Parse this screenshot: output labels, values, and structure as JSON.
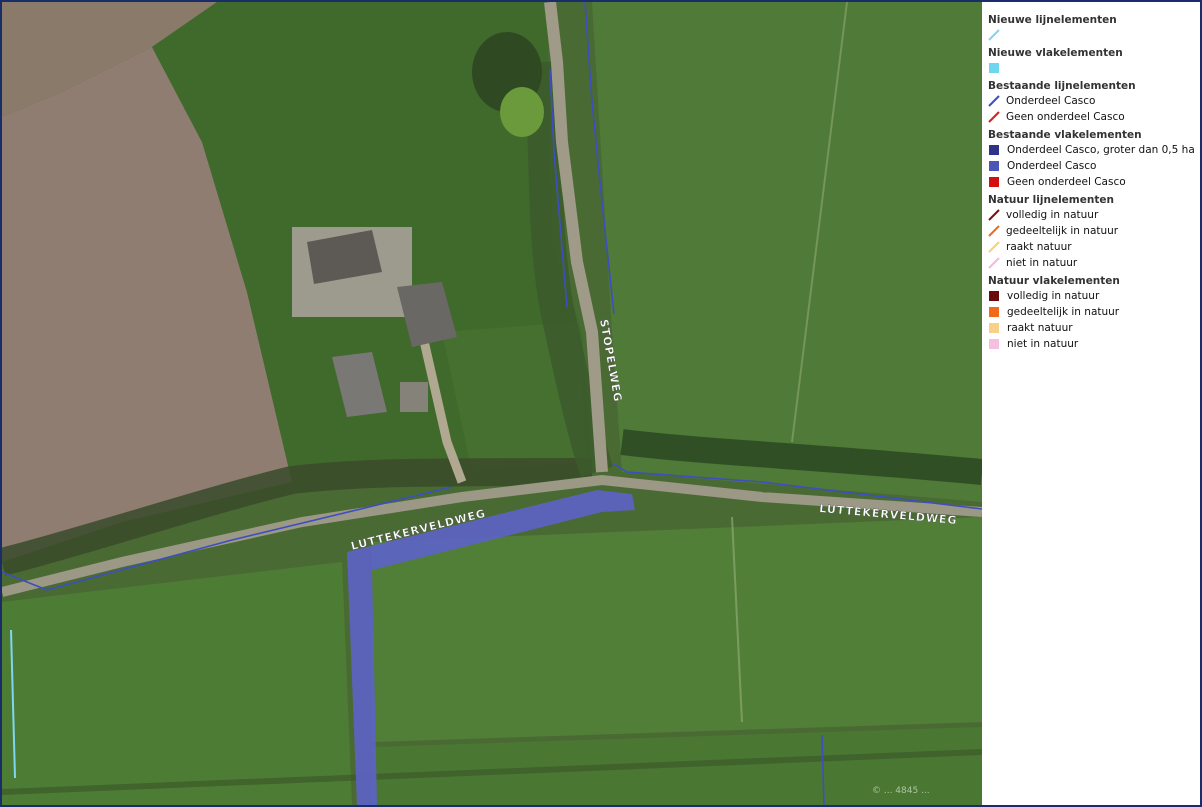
{
  "map": {
    "road_labels": {
      "stopelweg": "STOPELWEG",
      "luttekerveldweg_west": "LUTTEKERVELDWEG",
      "luttekerveldweg_east": "LUTTEKERVELDWEG"
    },
    "attribution": "© ... 4845 ..."
  },
  "legend": {
    "sections": [
      {
        "title": "Nieuwe lijnelementen",
        "items": [
          {
            "kind": "line",
            "color": "#7fd6f2",
            "label": ""
          }
        ]
      },
      {
        "title": "Nieuwe vlakelementen",
        "items": [
          {
            "kind": "square",
            "color": "#6fd6f0",
            "label": ""
          }
        ]
      },
      {
        "title": "Bestaande lijnelementen",
        "items": [
          {
            "kind": "line",
            "color": "#3d4fbf",
            "label": "Onderdeel Casco"
          },
          {
            "kind": "line",
            "color": "#d42020",
            "label": "Geen onderdeel Casco"
          }
        ]
      },
      {
        "title": "Bestaande vlakelementen",
        "items": [
          {
            "kind": "square",
            "color": "#2e3288",
            "label": "Onderdeel Casco, groter dan 0,5 ha"
          },
          {
            "kind": "square",
            "color": "#4b57b8",
            "label": "Onderdeel Casco"
          },
          {
            "kind": "square",
            "color": "#d40f0f",
            "label": "Geen onderdeel Casco"
          }
        ]
      },
      {
        "title": "Natuur lijnelementen",
        "items": [
          {
            "kind": "line",
            "color": "#7a1010",
            "label": "volledig in natuur"
          },
          {
            "kind": "line",
            "color": "#f06a1a",
            "label": "gedeeltelijk in natuur"
          },
          {
            "kind": "line",
            "color": "#f7d07a",
            "label": "raakt natuur"
          },
          {
            "kind": "line",
            "color": "#f6b8dc",
            "label": "niet in natuur"
          }
        ]
      },
      {
        "title": "Natuur vlakelementen",
        "items": [
          {
            "kind": "square",
            "color": "#6b0a0a",
            "label": "volledig in natuur"
          },
          {
            "kind": "square",
            "color": "#f06a1a",
            "label": "gedeeltelijk in natuur"
          },
          {
            "kind": "square",
            "color": "#f8d08a",
            "label": "raakt natuur"
          },
          {
            "kind": "square",
            "color": "#f5c0e0",
            "label": "niet in natuur"
          }
        ]
      }
    ]
  }
}
